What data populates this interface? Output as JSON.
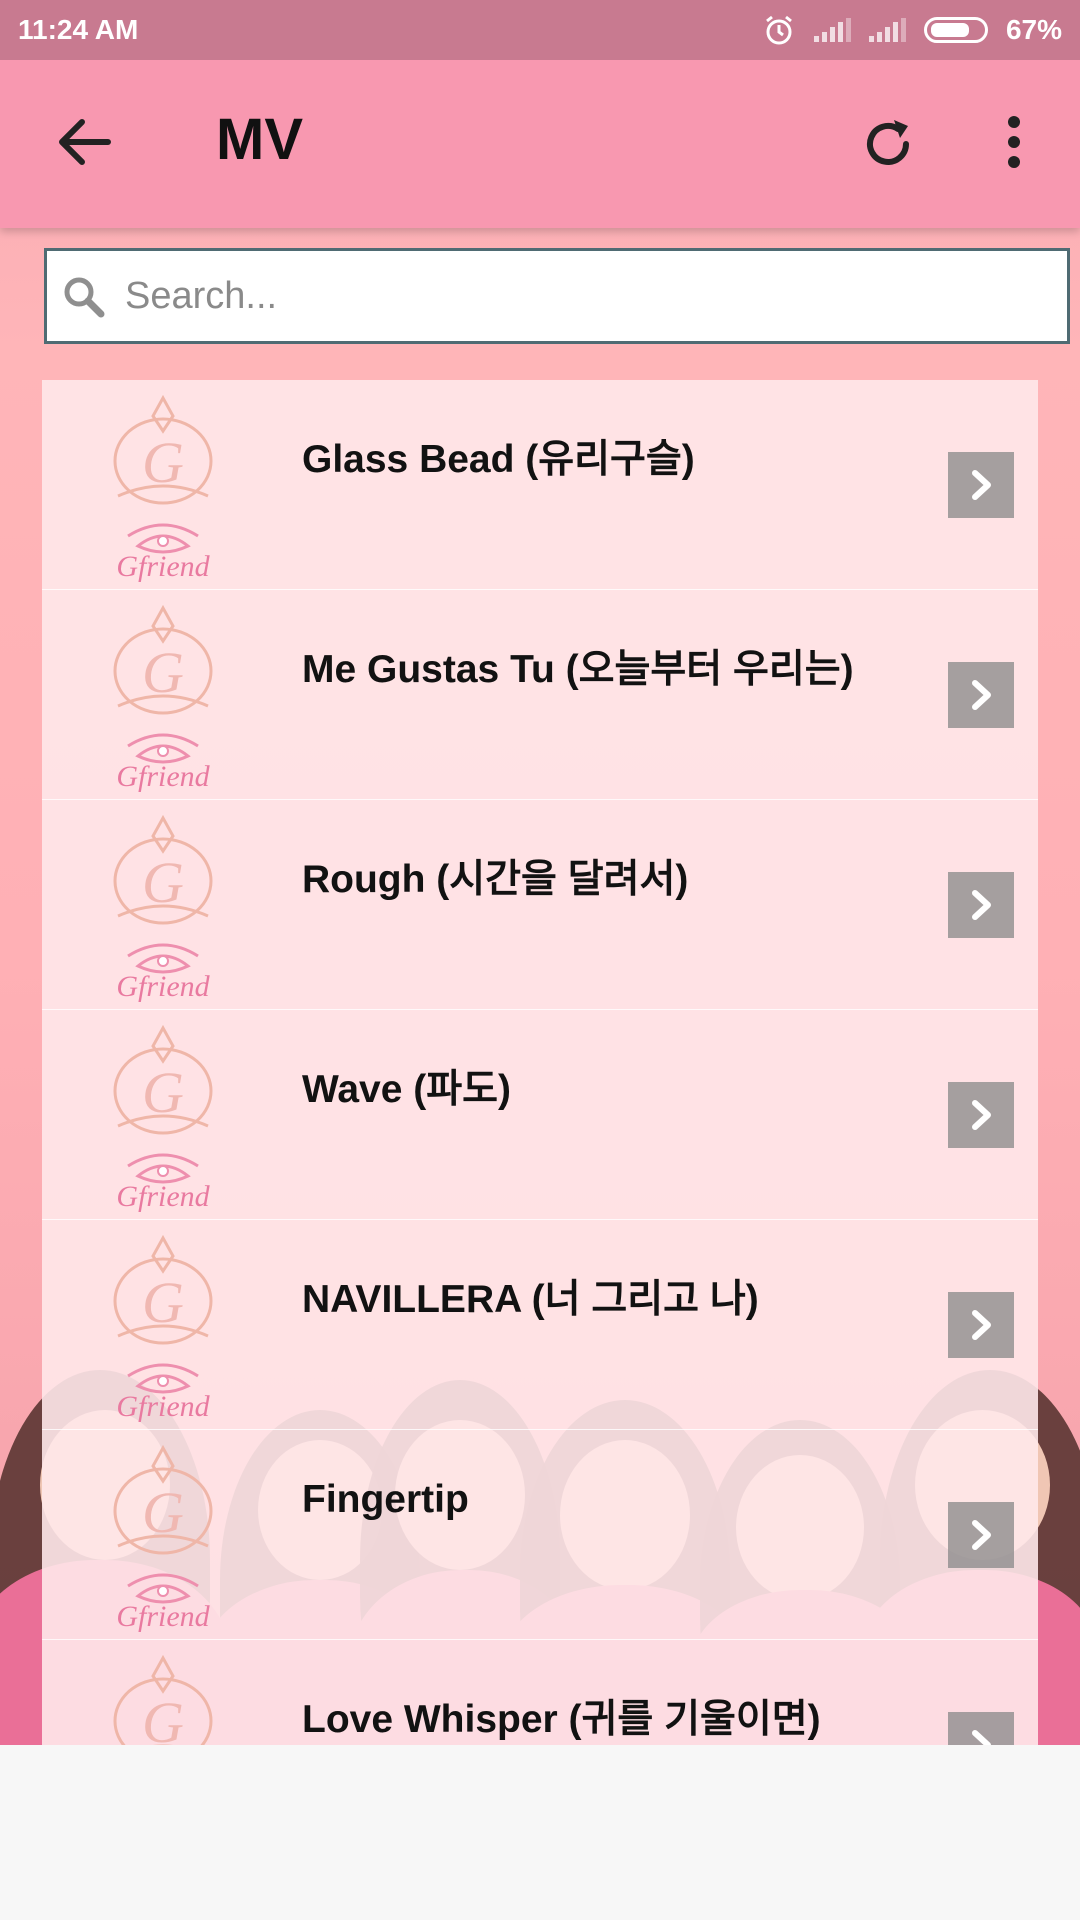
{
  "status_bar": {
    "time": "11:24 AM",
    "battery": "67%",
    "icons": [
      "alarm-icon",
      "signal-icon",
      "signal-icon",
      "battery-icon"
    ]
  },
  "app_bar": {
    "title": "MV",
    "icons": [
      "back-arrow-icon",
      "refresh-icon",
      "more-vert-icon"
    ]
  },
  "search": {
    "placeholder": "Search...",
    "value": ""
  },
  "list": {
    "thumbnail_icon": "gfriend-logo",
    "action_icon": "chevron-right-icon",
    "items": [
      {
        "title": "Glass Bead (유리구슬)"
      },
      {
        "title": "Me Gustas Tu (오늘부터 우리는)"
      },
      {
        "title": "Rough (시간을 달려서)"
      },
      {
        "title": "Wave (파도)"
      },
      {
        "title": "NAVILLERA (너 그리고 나)"
      },
      {
        "title": "Fingertip"
      },
      {
        "title": "Love Whisper (귀를 기울이면)"
      }
    ]
  },
  "colors": {
    "status_bar": "#c87a90",
    "app_bar": "#f898b0",
    "background": "#ffb2b8",
    "row": "#ffe8ea",
    "chevron_box": "#8c8c8c",
    "search_border": "#4f6b73"
  }
}
